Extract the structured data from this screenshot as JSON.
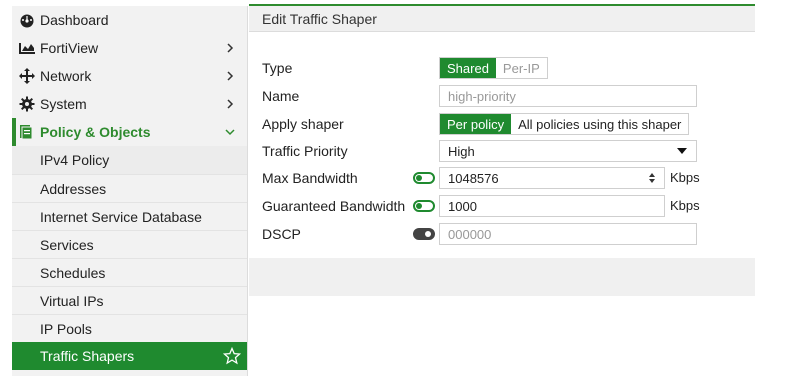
{
  "sidebar": {
    "items": [
      {
        "label": "Dashboard",
        "icon": "dashboard-icon"
      },
      {
        "label": "FortiView",
        "icon": "fortiview-icon",
        "expandable": true
      },
      {
        "label": "Network",
        "icon": "network-icon",
        "expandable": true
      },
      {
        "label": "System",
        "icon": "gear-icon",
        "expandable": true
      },
      {
        "label": "Policy & Objects",
        "icon": "policy-objects-icon",
        "expanded": true
      }
    ],
    "subitems": [
      "IPv4 Policy",
      "Addresses",
      "Internet Service Database",
      "Services",
      "Schedules",
      "Virtual IPs",
      "IP Pools",
      "Traffic Shapers"
    ],
    "selected_subitem": "Traffic Shapers",
    "accent": "#1f8a2f"
  },
  "panel": {
    "title": "Edit Traffic Shaper"
  },
  "form": {
    "type": {
      "label": "Type",
      "options": [
        "Shared",
        "Per-IP"
      ],
      "selected": "Shared"
    },
    "name": {
      "label": "Name",
      "placeholder": "high-priority",
      "value": ""
    },
    "apply_shaper": {
      "label": "Apply shaper",
      "options": [
        "Per policy",
        "All policies using this shaper"
      ],
      "selected": "Per policy"
    },
    "traffic_priority": {
      "label": "Traffic Priority",
      "value": "High"
    },
    "max_bandwidth": {
      "label": "Max Bandwidth",
      "enabled": true,
      "value": "1048576",
      "unit": "Kbps"
    },
    "guaranteed_bandwidth": {
      "label": "Guaranteed Bandwidth",
      "enabled": true,
      "value": "1000",
      "unit": "Kbps"
    },
    "dscp": {
      "label": "DSCP",
      "enabled": false,
      "placeholder": "000000"
    }
  }
}
